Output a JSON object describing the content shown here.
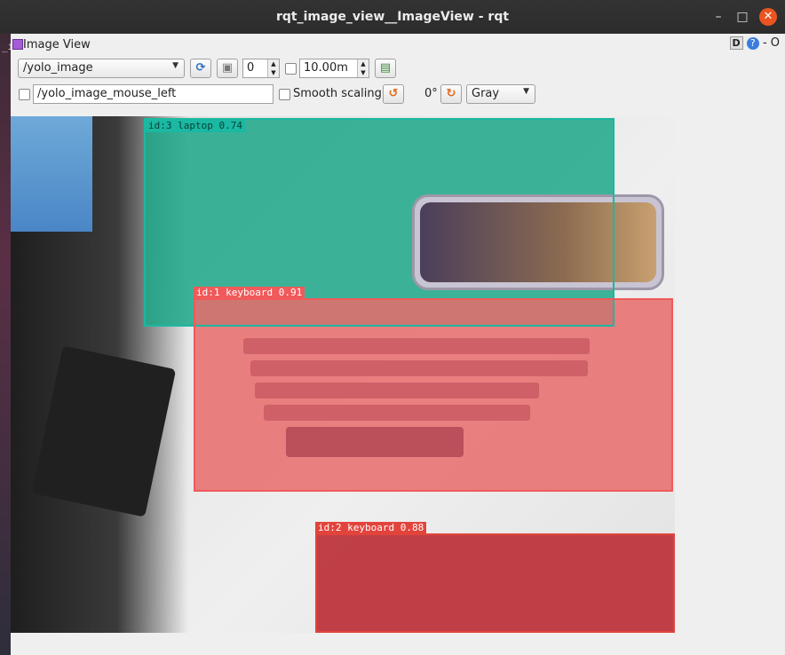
{
  "window": {
    "title": "rqt_image_view__ImageView - rqt",
    "close_glyph": "✕",
    "min_glyph": "–",
    "max_glyph": "□"
  },
  "desktop": {
    "left_fragment": "_i"
  },
  "dock": {
    "label": "Image View",
    "right_d": "D",
    "right_q": "?",
    "right_tail": "- O"
  },
  "toolbar": {
    "topic": "/yolo_image",
    "refresh_icon": "refresh-icon",
    "save_icon": "save-icon",
    "num_value": "0",
    "timeout_value": "10.00m",
    "mouse_topic": "/yolo_image_mouse_left",
    "smooth_label": "Smooth scaling",
    "rotate_value": "0°",
    "color_mode": "Gray"
  },
  "detections": [
    {
      "label": "id:3 laptop 0.74",
      "color": "#1bb8a2"
    },
    {
      "label": "id:1 keyboard 0.91",
      "color": "#f05a5a"
    },
    {
      "label": "id:2 keyboard 0.88",
      "color": "#e2443c"
    }
  ]
}
